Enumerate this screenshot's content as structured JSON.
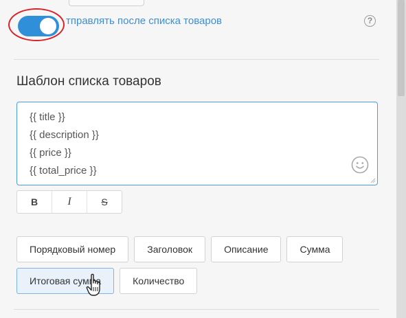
{
  "toggle": {
    "label": "тправлять после списка товаров",
    "enabled": true,
    "help_icon": "question-circle-icon",
    "help_glyph": "?"
  },
  "template_section": {
    "title": "Шаблон списка товаров"
  },
  "editor": {
    "lines": [
      "{{ title }}",
      "{{ description }}",
      "{{ price }}",
      "{{ total_price }}"
    ],
    "emoji_icon": "smile-icon"
  },
  "formatting": {
    "bold": "B",
    "italic": "I",
    "strike": "S"
  },
  "variable_buttons": {
    "row1": [
      "Порядковый номер",
      "Заголовок",
      "Описание",
      "Сумма"
    ],
    "row2": [
      "Итоговая сумма",
      "Количество"
    ]
  },
  "colors": {
    "accent": "#2f8fd8",
    "label_blue": "#3a8fd6",
    "annotation_red": "#d9232b"
  }
}
